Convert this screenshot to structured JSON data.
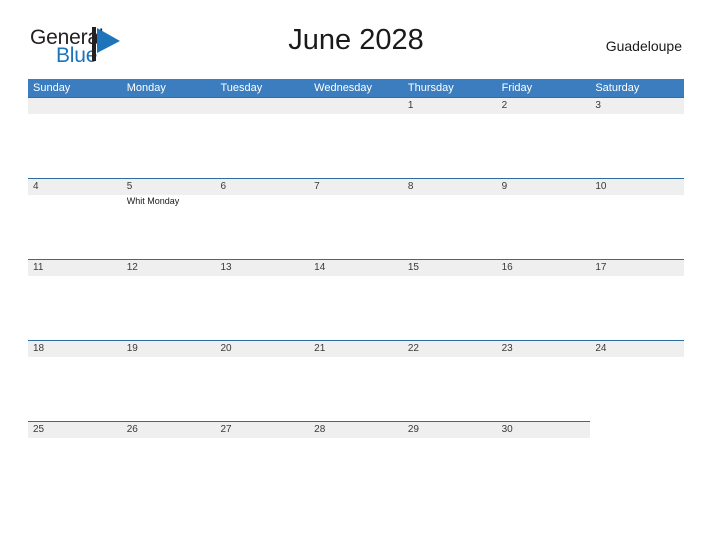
{
  "brand": {
    "name_part1": "General",
    "name_part2": "Blue",
    "flag_color": "#1d74bb",
    "pole_color": "#231f20"
  },
  "header": {
    "title": "June 2028",
    "region": "Guadeloupe"
  },
  "colors": {
    "header_blue": "#3b7dbe",
    "row_line_blue": "#2e6da4",
    "date_band_gray": "#efefef",
    "page_background": "#ffffff"
  },
  "calendar": {
    "month": "June",
    "year": "2028",
    "weekday_headers": [
      "Sunday",
      "Monday",
      "Tuesday",
      "Wednesday",
      "Thursday",
      "Friday",
      "Saturday"
    ],
    "weeks": [
      [
        {
          "day": "",
          "events": []
        },
        {
          "day": "",
          "events": []
        },
        {
          "day": "",
          "events": []
        },
        {
          "day": "",
          "events": []
        },
        {
          "day": "1",
          "events": []
        },
        {
          "day": "2",
          "events": []
        },
        {
          "day": "3",
          "events": []
        }
      ],
      [
        {
          "day": "4",
          "events": []
        },
        {
          "day": "5",
          "events": [
            "Whit Monday"
          ]
        },
        {
          "day": "6",
          "events": []
        },
        {
          "day": "7",
          "events": []
        },
        {
          "day": "8",
          "events": []
        },
        {
          "day": "9",
          "events": []
        },
        {
          "day": "10",
          "events": []
        }
      ],
      [
        {
          "day": "11",
          "events": []
        },
        {
          "day": "12",
          "events": []
        },
        {
          "day": "13",
          "events": []
        },
        {
          "day": "14",
          "events": []
        },
        {
          "day": "15",
          "events": []
        },
        {
          "day": "16",
          "events": []
        },
        {
          "day": "17",
          "events": []
        }
      ],
      [
        {
          "day": "18",
          "events": []
        },
        {
          "day": "19",
          "events": []
        },
        {
          "day": "20",
          "events": []
        },
        {
          "day": "21",
          "events": []
        },
        {
          "day": "22",
          "events": []
        },
        {
          "day": "23",
          "events": []
        },
        {
          "day": "24",
          "events": []
        }
      ],
      [
        {
          "day": "25",
          "events": []
        },
        {
          "day": "26",
          "events": []
        },
        {
          "day": "27",
          "events": []
        },
        {
          "day": "28",
          "events": []
        },
        {
          "day": "29",
          "events": []
        },
        {
          "day": "30",
          "events": []
        },
        {
          "day": "",
          "events": []
        }
      ]
    ]
  }
}
